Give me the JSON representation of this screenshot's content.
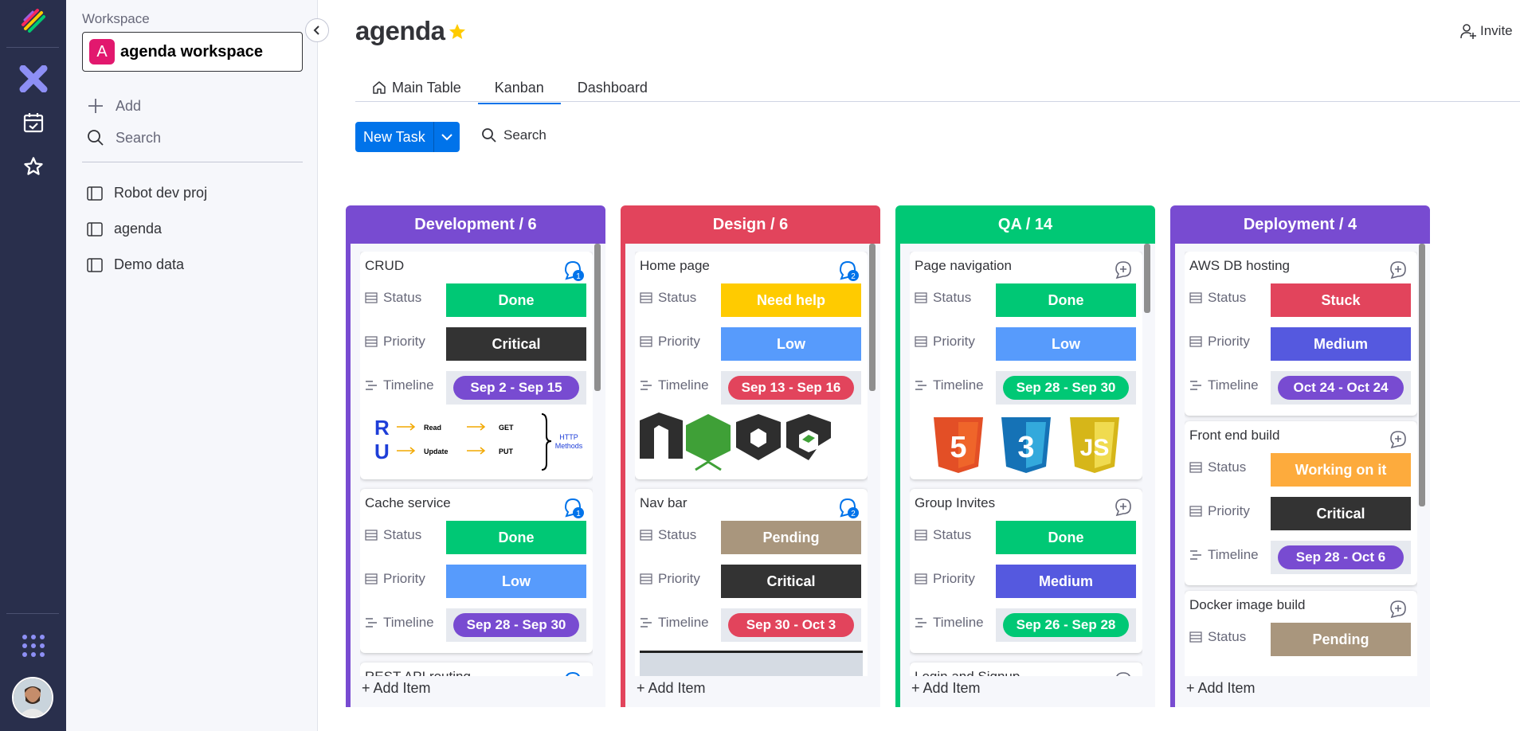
{
  "workspace": {
    "label": "Workspace",
    "badge": "A",
    "name": "agenda workspace"
  },
  "sidebar": {
    "add_label": "Add",
    "search_label": "Search",
    "boards": [
      {
        "label": "Robot dev proj"
      },
      {
        "label": "agenda"
      },
      {
        "label": "Demo data"
      }
    ]
  },
  "header": {
    "title": "agenda",
    "invite_label": "Invite"
  },
  "tabs": [
    {
      "label": "Main Table"
    },
    {
      "label": "Kanban"
    },
    {
      "label": "Dashboard"
    }
  ],
  "toolbar": {
    "new_task_label": "New Task",
    "search_label": "Search"
  },
  "field_labels": {
    "status": "Status",
    "priority": "Priority",
    "timeline": "Timeline"
  },
  "add_item_label": "+ Add Item",
  "colors": {
    "done": "#00c875",
    "critical": "#333333",
    "low": "#579bfc",
    "medium": "#5559df",
    "stuck": "#e2445c",
    "need_help": "#ffcb00",
    "pending": "#a9967d",
    "working_on_it": "#fdab3d",
    "purple": "#784bd1",
    "red": "#e2445c",
    "green": "#00c875",
    "accent": "#0073ea"
  },
  "columns": [
    {
      "title": "Development / 6",
      "cards": [
        {
          "title": "CRUD",
          "updates": "1",
          "status": "Done",
          "priority": "Critical",
          "timeline": "Sep 2 - Sep 15",
          "diagram": {
            "r": "R",
            "u": "U",
            "read": "Read",
            "update": "Update",
            "get": "GET",
            "put": "PUT",
            "http_line1": "HTTP",
            "http_line2": "Methods"
          }
        },
        {
          "title": "Cache service",
          "updates": "1",
          "status": "Done",
          "priority": "Low",
          "timeline": "Sep 28 - Sep 30"
        },
        {
          "title": "REST API routing"
        }
      ]
    },
    {
      "title": "Design / 6",
      "cards": [
        {
          "title": "Home page",
          "updates": "2",
          "status": "Need help",
          "priority": "Low",
          "timeline": "Sep 13 - Sep 16"
        },
        {
          "title": "Nav bar",
          "updates": "2",
          "status": "Pending",
          "priority": "Critical",
          "timeline": "Sep 30 - Oct 3"
        }
      ]
    },
    {
      "title": "QA / 14",
      "cards": [
        {
          "title": "Page navigation",
          "status": "Done",
          "priority": "Low",
          "timeline": "Sep 28 - Sep 30",
          "logos": {
            "html": "5",
            "css": "3",
            "js": "JS"
          }
        },
        {
          "title": "Group Invites",
          "status": "Done",
          "priority": "Medium",
          "timeline": "Sep 26 - Sep 28"
        },
        {
          "title": "Login and Signup"
        }
      ]
    },
    {
      "title": "Deployment / 4",
      "cards": [
        {
          "title": "AWS DB hosting",
          "status": "Stuck",
          "priority": "Medium",
          "timeline": "Oct 24 - Oct 24"
        },
        {
          "title": "Front end build",
          "status": "Working on it",
          "priority": "Critical",
          "timeline": "Sep 28 - Oct 6"
        },
        {
          "title": "Docker image build",
          "status": "Pending"
        }
      ]
    }
  ]
}
